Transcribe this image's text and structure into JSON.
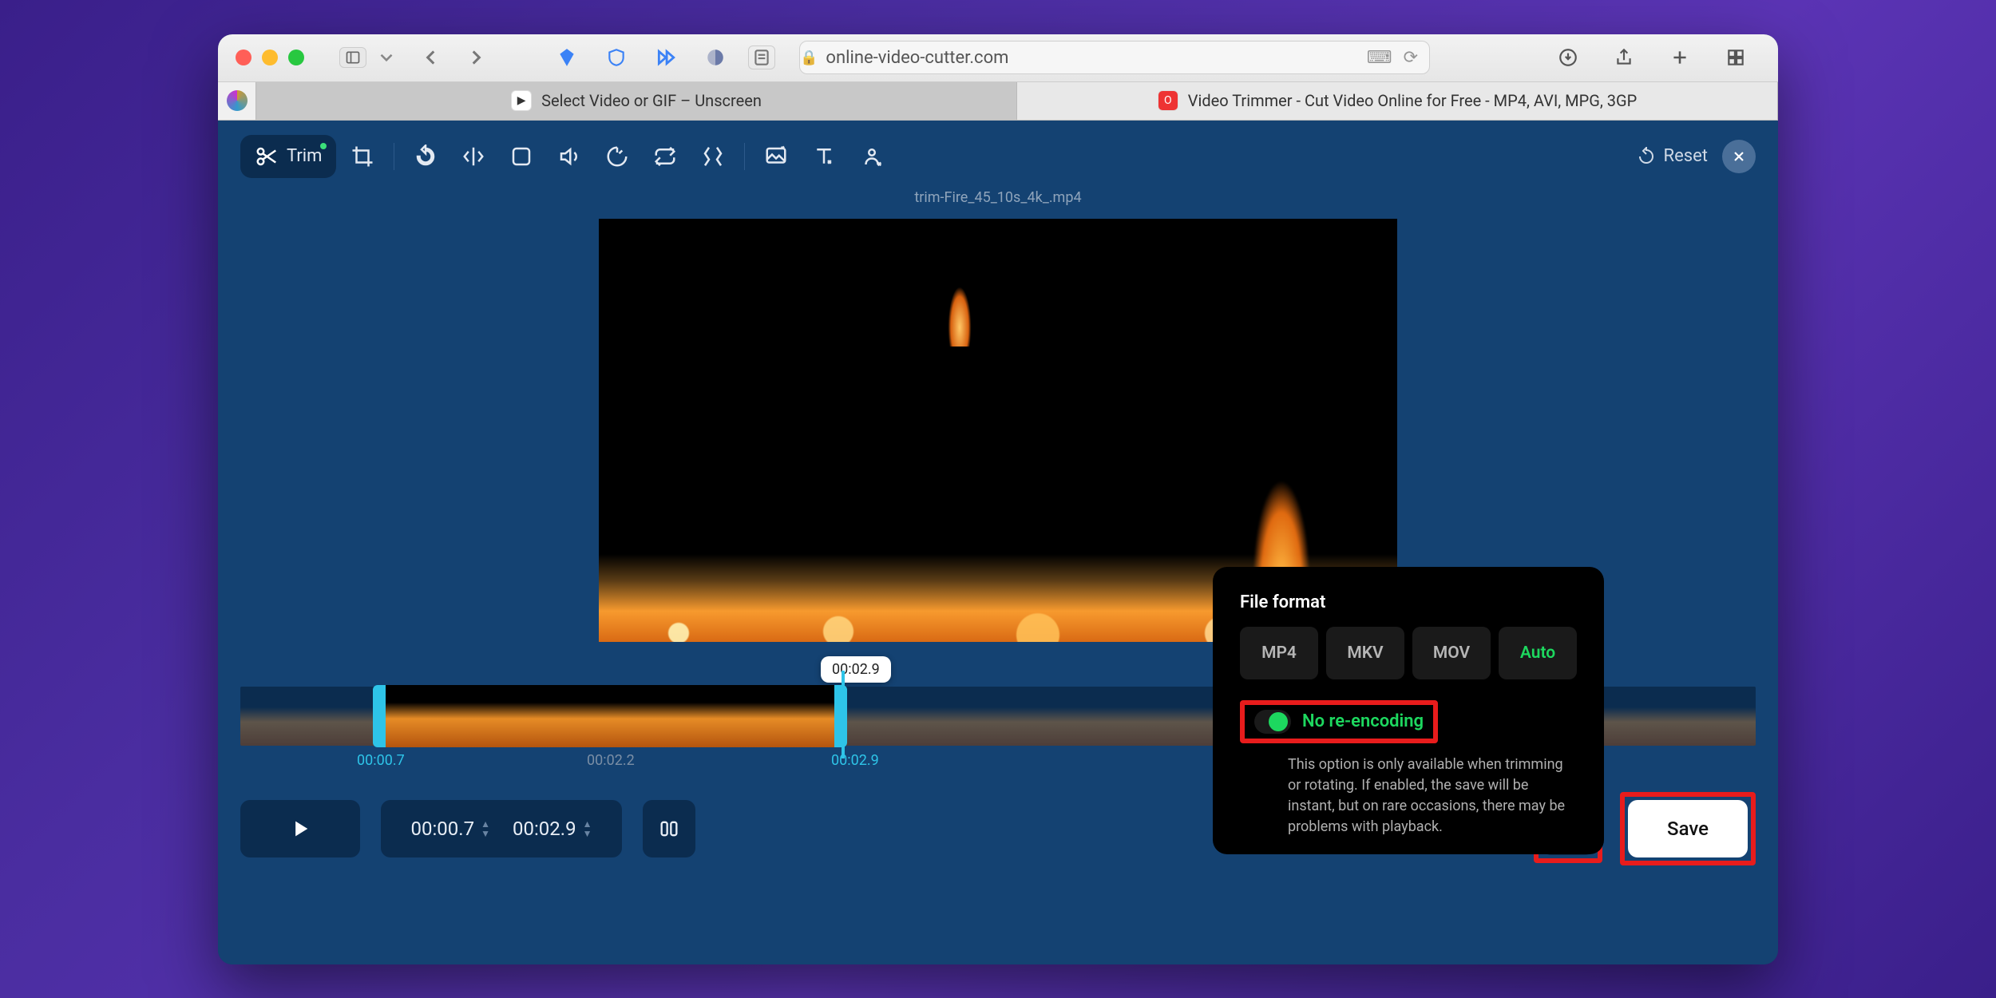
{
  "browser": {
    "url": "online-video-cutter.com",
    "tabs": {
      "pinned_icon": "clickup",
      "tab1": {
        "label": "Select Video or GIF – Unscreen"
      },
      "tab2": {
        "label": "Video Trimmer - Cut Video Online for Free - MP4, AVI, MPG, 3GP"
      }
    }
  },
  "app": {
    "toolbar": {
      "trim_label": "Trim"
    },
    "reset_label": "Reset",
    "filename": "trim-Fire_45_10s_4k_.mp4",
    "timeline": {
      "tooltip": "00:02.9",
      "start_label": "00:00.7",
      "mid_label": "00:02.2",
      "end_label": "00:02.9"
    },
    "bottombar": {
      "start_time": "00:00.7",
      "end_time": "00:02.9",
      "save_label": "Save"
    },
    "popup": {
      "heading": "File format",
      "formats": {
        "mp4": "MP4",
        "mkv": "MKV",
        "mov": "MOV",
        "auto": "Auto"
      },
      "noenc_label": "No re-encoding",
      "noenc_desc": "This option is only available when trimming or rotating. If enabled, the save will be instant, but on rare occasions, there may be problems with playback."
    }
  }
}
